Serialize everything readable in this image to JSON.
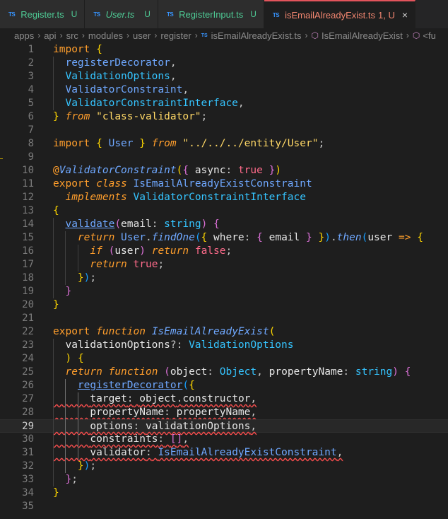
{
  "tabs": [
    {
      "label": "Register.ts",
      "status": "U",
      "active": false,
      "italic": false
    },
    {
      "label": "User.ts",
      "status": "U",
      "active": false,
      "italic": true
    },
    {
      "label": "RegisterInput.ts",
      "status": "U",
      "active": false,
      "italic": false
    },
    {
      "label": "isEmailAlreadyExist.ts",
      "status": "1, U",
      "active": true,
      "italic": false
    }
  ],
  "tab_icon_text": "TS",
  "breadcrumb": [
    "apps",
    "api",
    "src",
    "modules",
    "user",
    "register",
    "isEmailAlreadyExist.ts",
    "IsEmailAlreadyExist",
    "<fu"
  ],
  "colors": {
    "active_tab_accent": "#e2545c",
    "error": "#f14c4c",
    "keyword": "#ff9e2c",
    "string": "#ffd866",
    "function": "#6fa8ff"
  },
  "current_line": 29,
  "code_lines": [
    "import {",
    "  registerDecorator,",
    "  ValidationOptions,",
    "  ValidatorConstraint,",
    "  ValidatorConstraintInterface,",
    "} from \"class-validator\";",
    "",
    "import { User } from \"../../../entity/User\";",
    "",
    "@ValidatorConstraint({ async: true })",
    "export class IsEmailAlreadyExistConstraint",
    "  implements ValidatorConstraintInterface",
    "{",
    "  validate(email: string) {",
    "    return User.findOne({ where: { email } }).then(user => {",
    "      if (user) return false;",
    "      return true;",
    "    });",
    "  }",
    "}",
    "",
    "export function IsEmailAlreadyExist(",
    "  validationOptions?: ValidationOptions",
    "  ) {",
    "  return function (object: Object, propertyName: string) {",
    "    registerDecorator({",
    "      target: object.constructor,",
    "      propertyName: propertyName,",
    "      options: validationOptions,",
    "      constraints: [],",
    "      validator: IsEmailAlreadyExistConstraint,",
    "    });",
    "  };",
    "}",
    ""
  ]
}
